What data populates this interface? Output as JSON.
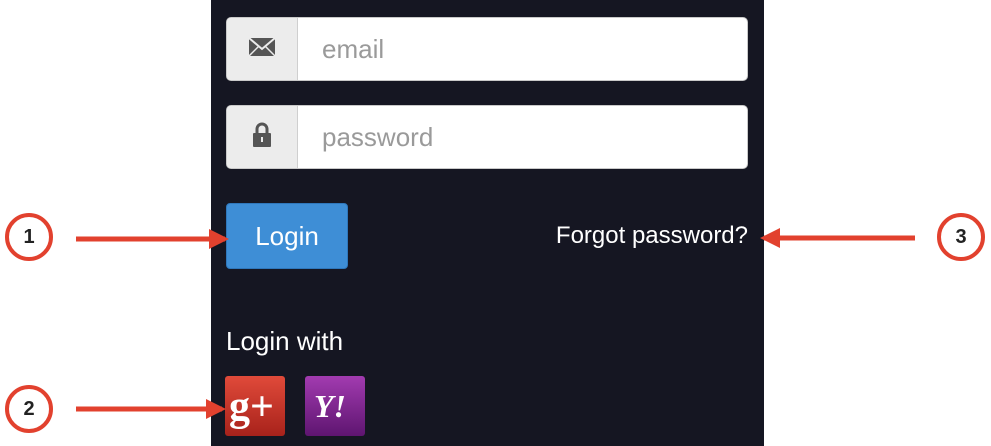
{
  "form": {
    "email_placeholder": "email",
    "password_placeholder": "password",
    "login_label": "Login",
    "forgot_label": "Forgot password?",
    "login_with_label": "Login with"
  },
  "social": {
    "google_icon": "google-plus-icon",
    "yahoo_icon": "yahoo-icon",
    "google_text": "g+",
    "yahoo_text": "Y!"
  },
  "annotations": {
    "c1": "1",
    "c2": "2",
    "c3": "3"
  },
  "colors": {
    "panel_bg": "#151622",
    "login_btn": "#3e8ed6",
    "annotation_red": "#e2412e",
    "google_red": "#c8322a",
    "yahoo_purple": "#7b1b86"
  }
}
